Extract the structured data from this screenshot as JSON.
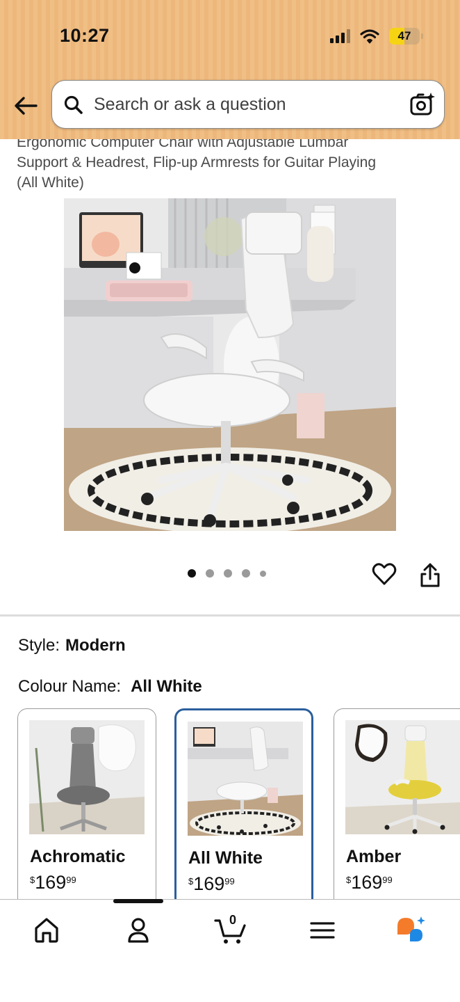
{
  "status_bar": {
    "time": "10:27",
    "battery": "47"
  },
  "search": {
    "placeholder": "Search or ask a question"
  },
  "product": {
    "title_line1": "Ergonomic Computer Chair with Adjustable Lumbar",
    "title_line2": "Support & Headrest, Flip-up Armrests for Guitar Playing",
    "title_line3": "(All White)",
    "image_count": 5,
    "active_image_index": 0
  },
  "style": {
    "label": "Style:",
    "value": "Modern"
  },
  "colour": {
    "label": "Colour Name:",
    "value": "All White"
  },
  "variants": [
    {
      "name": "Achromatic",
      "currency": "$",
      "price_whole": "169",
      "price_fraction": "99",
      "selected": false
    },
    {
      "name": "All White",
      "currency": "$",
      "price_whole": "169",
      "price_fraction": "99",
      "selected": true
    },
    {
      "name": "Amber",
      "currency": "$",
      "price_whole": "169",
      "price_fraction": "99",
      "selected": false
    }
  ],
  "bottom_nav": {
    "items": [
      "home-icon",
      "account-icon",
      "cart-icon",
      "menu-icon",
      "rufus-icon"
    ],
    "cart_count": "0"
  },
  "colors": {
    "header_bg": "#f0bf85",
    "selected_border": "#2b5e9c",
    "rufus_orange": "#f47b2a",
    "rufus_blue": "#1e88e5"
  }
}
